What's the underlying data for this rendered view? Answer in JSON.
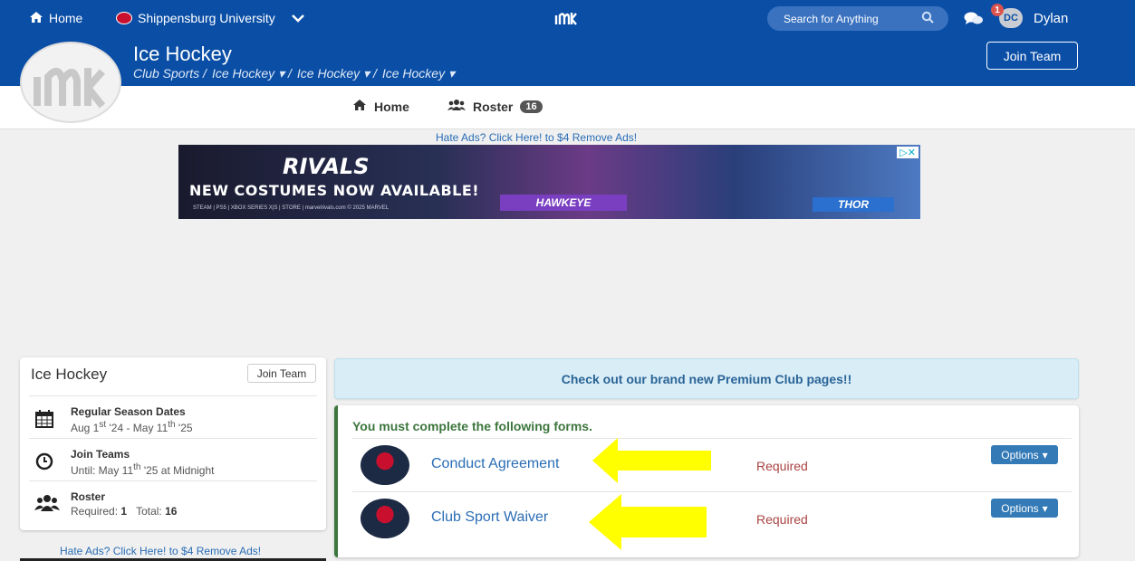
{
  "topnav": {
    "home_label": "Home",
    "school_label": "Shippensburg University",
    "search_placeholder": "Search for Anything",
    "notification_count": "1",
    "avatar_initials": "DC",
    "user_name": "Dylan"
  },
  "team": {
    "title": "Ice Hockey",
    "breadcrumb": [
      "Club Sports /",
      "Ice Hockey ▾ /",
      "Ice Hockey ▾ /",
      "Ice Hockey ▾"
    ],
    "join_label": "Join Team"
  },
  "subnav": {
    "home_label": "Home",
    "roster_label": "Roster",
    "roster_count": "16"
  },
  "ads": {
    "remove_ads_label": "Hate Ads? Click Here! to $4 Remove Ads!",
    "banner_logo": "RIVALS",
    "banner_headline": "NEW COSTUMES NOW AVAILABLE!",
    "banner_hero_1": "HAWKEYE",
    "banner_hero_2": "THOR",
    "banner_small": "STEAM | PS5 | XBOX SERIES X|S | STORE | marvelrivals.com © 2025 MARVEL"
  },
  "infocard": {
    "title": "Ice Hockey",
    "join_label": "Join Team",
    "season": {
      "head": "Regular Season Dates",
      "start": "Aug 1",
      "start_sup": "st",
      "start_year": " '24 - May 11",
      "end_sup": "th",
      "end_year": " '25"
    },
    "join_teams": {
      "head": "Join Teams",
      "prefix": "Until: May 11",
      "sup": "th",
      "suffix": " '25 at Midnight"
    },
    "roster": {
      "head": "Roster",
      "required_label": "Required:",
      "required_value": "1",
      "total_label": "Total:",
      "total_value": "16"
    }
  },
  "promo": {
    "text": "Check out our brand new Premium Club pages!!"
  },
  "forms": {
    "title": "You must complete the following forms.",
    "items": [
      {
        "name": "Conduct Agreement",
        "status": "Required",
        "options_label": "Options"
      },
      {
        "name": "Club Sport Waiver",
        "status": "Required",
        "options_label": "Options"
      }
    ]
  },
  "colors": {
    "brand_blue": "#0a4ea6",
    "success_green": "#3c763d",
    "required_red": "#a94442",
    "annotation_yellow": "#ffff00"
  }
}
